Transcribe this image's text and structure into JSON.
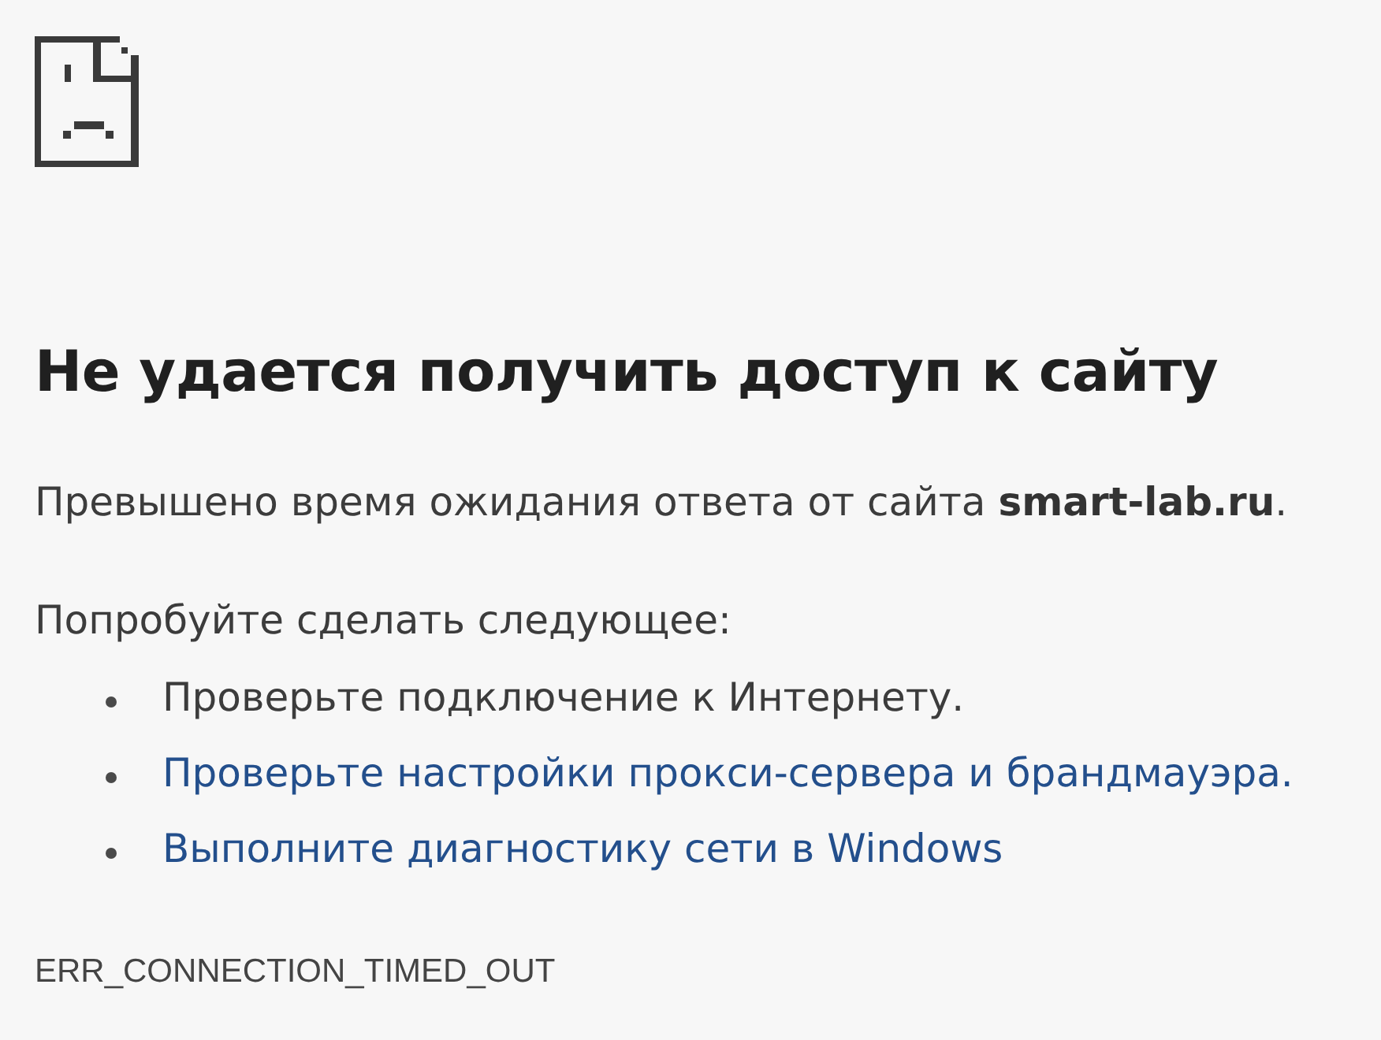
{
  "heading": "Не удается получить доступ к сайту",
  "message": "Превышено время ожидания ответа от сайта **smart-lab.ru**.",
  "suggestions_title": "Попробуйте сделать следующее:",
  "suggestions": [
    {
      "kind": "text",
      "text": "Проверьте подключение к Интернету."
    },
    {
      "kind": "link",
      "text": "Проверьте настройки прокси-сервера и брандмауэра."
    },
    {
      "kind": "link",
      "text": "Выполните диагностику сети в Windows"
    }
  ],
  "error_code": "ERR_CONNECTION_TIMED_OUT"
}
